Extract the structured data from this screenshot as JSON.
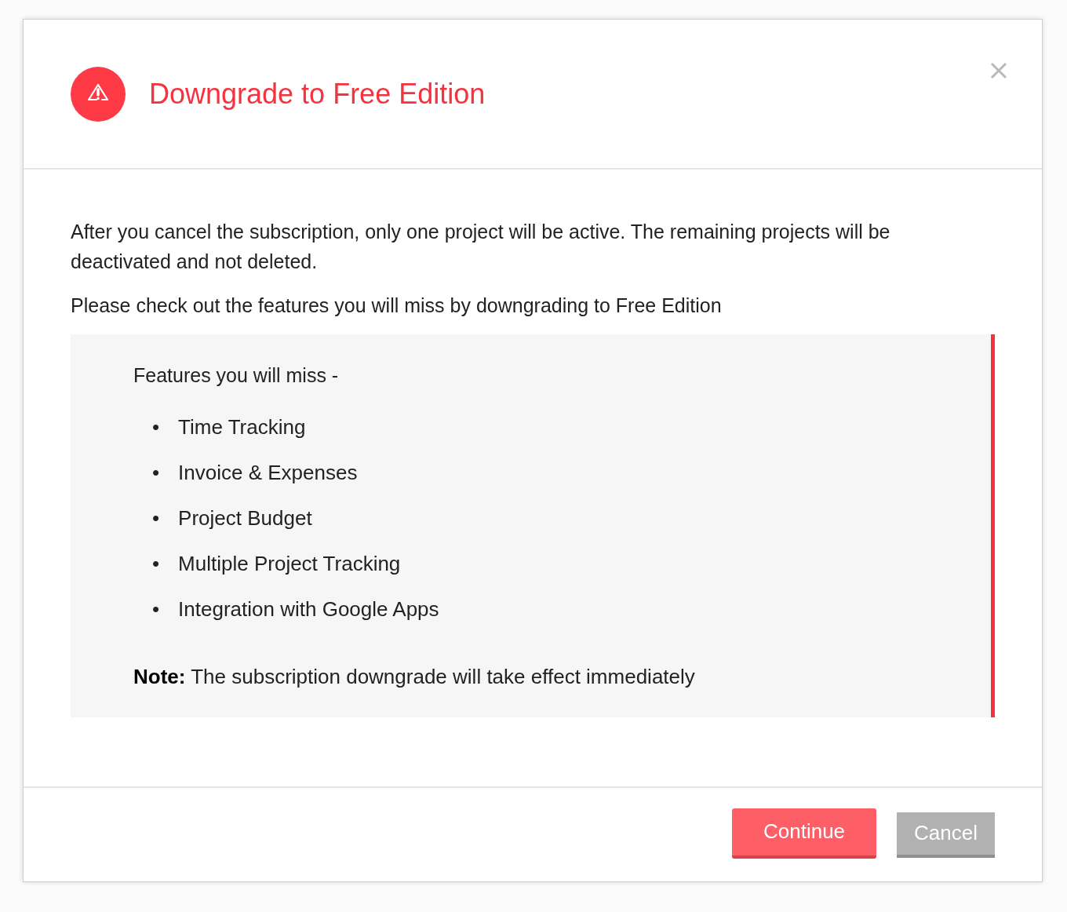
{
  "dialog": {
    "title": "Downgrade to Free Edition",
    "paragraphs": [
      "After you cancel the subscription, only one project will be active. The remaining projects will be deactivated and not deleted.",
      "Please check out the features you will miss by downgrading to Free Edition"
    ],
    "callout": {
      "heading": "Features you will miss -",
      "items": [
        {
          "marker": "•",
          "label": "Time Tracking"
        },
        {
          "marker": "•",
          "label": "Invoice & Expenses"
        },
        {
          "marker": "•",
          "label": "Project Budget"
        },
        {
          "marker": "•",
          "label": "Multiple Project Tracking"
        },
        {
          "marker": "•",
          "label": "Integration with Google Apps"
        }
      ],
      "note": "**Note:** The subscription downgrade will take effect immediately"
    },
    "buttons": [
      {
        "label": "Continue",
        "kind": "primary"
      },
      {
        "label": "Cancel",
        "kind": "secondary"
      }
    ]
  }
}
